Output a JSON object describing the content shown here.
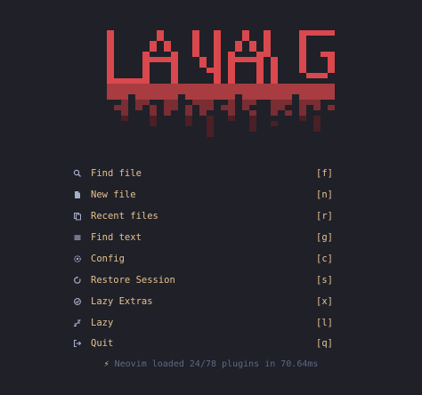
{
  "logo": {
    "text": "LAVAG",
    "color": "#d9484d",
    "drip_colors": [
      "#a83c40",
      "#7a2d32",
      "#4a1f25"
    ]
  },
  "menu": [
    {
      "icon": "search-icon",
      "label": "Find file",
      "key": "[f]"
    },
    {
      "icon": "new-file-icon",
      "label": "New file",
      "key": "[n]"
    },
    {
      "icon": "recent-files-icon",
      "label": "Recent files",
      "key": "[r]"
    },
    {
      "icon": "text-lines-icon",
      "label": "Find text",
      "key": "[g]"
    },
    {
      "icon": "gear-icon",
      "label": "Config",
      "key": "[c]"
    },
    {
      "icon": "restore-icon",
      "label": "Restore Session",
      "key": "[s]"
    },
    {
      "icon": "extras-icon",
      "label": "Lazy Extras",
      "key": "[x]"
    },
    {
      "icon": "sleep-icon",
      "label": "Lazy",
      "key": "[l]"
    },
    {
      "icon": "quit-icon",
      "label": "Quit",
      "key": "[q]"
    }
  ],
  "footer": {
    "icon": "lightning-icon",
    "bolt": "⚡",
    "text": "Neovim loaded 24/78 plugins in 70.64ms"
  },
  "colors": {
    "background": "#1f2028",
    "accent": "#e5c28f",
    "muted": "#5e6a85",
    "icon": "#a8aec8"
  }
}
